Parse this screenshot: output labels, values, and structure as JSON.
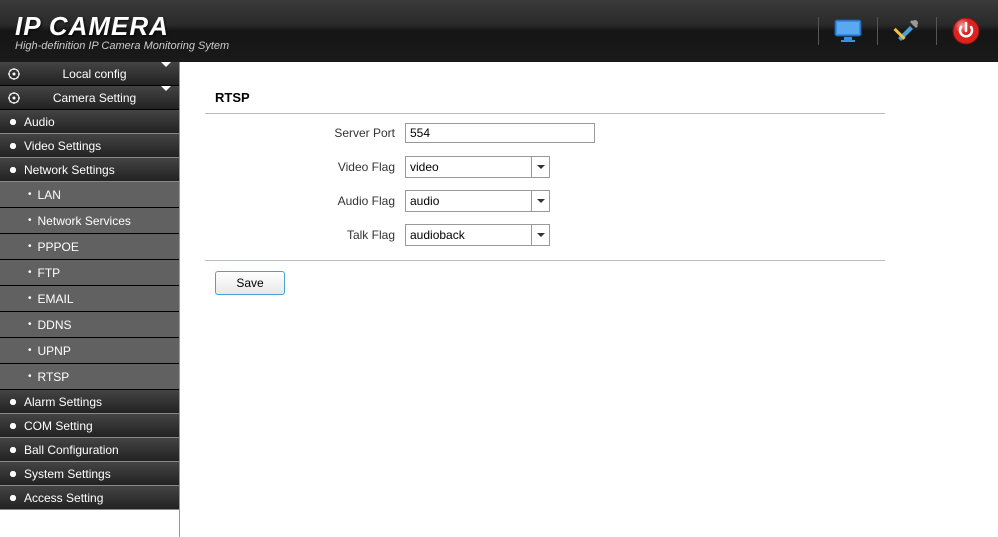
{
  "header": {
    "title": "IP CAMERA",
    "subtitle": "High-definition IP Camera Monitoring Sytem"
  },
  "sidebar": {
    "local_config": "Local config",
    "camera_setting": "Camera Setting",
    "audio": "Audio",
    "video_settings": "Video Settings",
    "network_settings": "Network Settings",
    "lan": "LAN",
    "network_services": "Network Services",
    "pppoe": "PPPOE",
    "ftp": "FTP",
    "email": "EMAIL",
    "ddns": "DDNS",
    "upnp": "UPNP",
    "rtsp": "RTSP",
    "alarm_settings": "Alarm Settings",
    "com_setting": "COM Setting",
    "ball_configuration": "Ball Configuration",
    "system_settings": "System Settings",
    "access_setting": "Access Setting"
  },
  "main": {
    "panel_title": "RTSP",
    "server_port_label": "Server Port",
    "server_port_value": "554",
    "video_flag_label": "Video Flag",
    "video_flag_value": "video",
    "audio_flag_label": "Audio Flag",
    "audio_flag_value": "audio",
    "talk_flag_label": "Talk Flag",
    "talk_flag_value": "audioback",
    "save_label": "Save"
  }
}
